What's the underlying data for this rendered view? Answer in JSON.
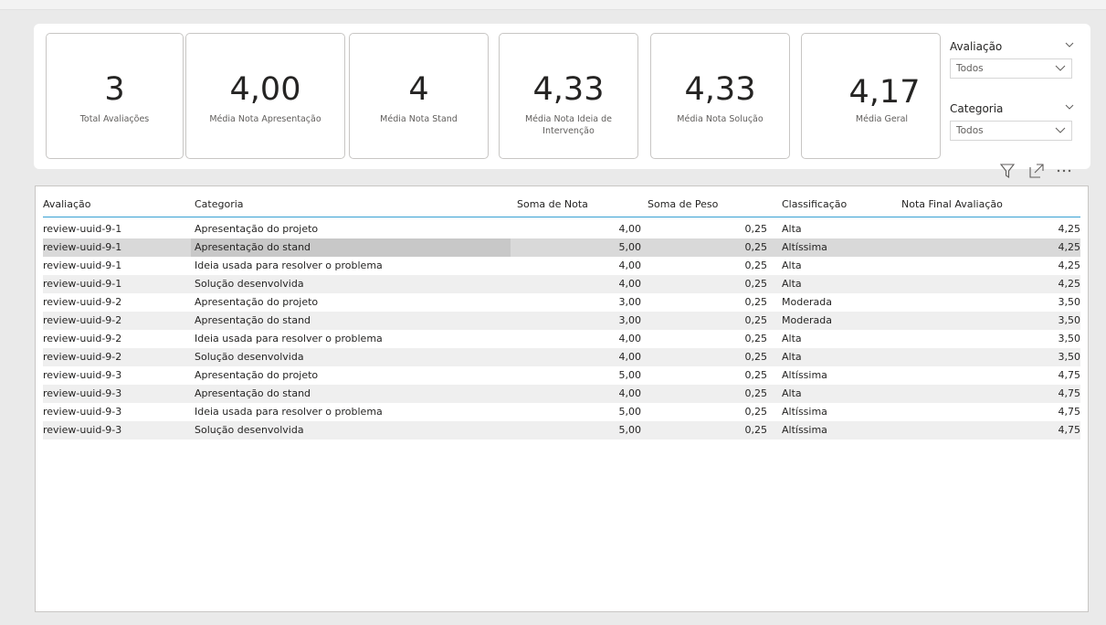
{
  "kpis": [
    {
      "value": "3",
      "label": "Total Avaliações"
    },
    {
      "value": "4,00",
      "label": "Média Nota Apresentação"
    },
    {
      "value": "4",
      "label": "Média Nota Stand"
    },
    {
      "value": "4,33",
      "label": "Média Nota Ideia de Intervenção"
    },
    {
      "value": "4,33",
      "label": "Média Nota Solução"
    },
    {
      "value": "4,17",
      "label": "Média Geral"
    }
  ],
  "slicers": [
    {
      "title": "Avaliação",
      "selected": "Todos"
    },
    {
      "title": "Categoria",
      "selected": "Todos"
    }
  ],
  "table": {
    "columns": [
      "Avaliação",
      "Categoria",
      "Soma de Nota",
      "Soma de Peso",
      "Classificação",
      "Nota Final Avaliação"
    ],
    "rows": [
      [
        "review-uuid-9-1",
        "Apresentação do projeto",
        "4,00",
        "0,25",
        "Alta",
        "4,25"
      ],
      [
        "review-uuid-9-1",
        "Apresentação do stand",
        "5,00",
        "0,25",
        "Altíssima",
        "4,25"
      ],
      [
        "review-uuid-9-1",
        "Ideia usada para resolver o problema",
        "4,00",
        "0,25",
        "Alta",
        "4,25"
      ],
      [
        "review-uuid-9-1",
        "Solução desenvolvida",
        "4,00",
        "0,25",
        "Alta",
        "4,25"
      ],
      [
        "review-uuid-9-2",
        "Apresentação do projeto",
        "3,00",
        "0,25",
        "Moderada",
        "3,50"
      ],
      [
        "review-uuid-9-2",
        "Apresentação do stand",
        "3,00",
        "0,25",
        "Moderada",
        "3,50"
      ],
      [
        "review-uuid-9-2",
        "Ideia usada para resolver o problema",
        "4,00",
        "0,25",
        "Alta",
        "3,50"
      ],
      [
        "review-uuid-9-2",
        "Solução desenvolvida",
        "4,00",
        "0,25",
        "Alta",
        "3,50"
      ],
      [
        "review-uuid-9-3",
        "Apresentação do projeto",
        "5,00",
        "0,25",
        "Altíssima",
        "4,75"
      ],
      [
        "review-uuid-9-3",
        "Apresentação do stand",
        "4,00",
        "0,25",
        "Alta",
        "4,75"
      ],
      [
        "review-uuid-9-3",
        "Ideia usada para resolver o problema",
        "5,00",
        "0,25",
        "Altíssima",
        "4,75"
      ],
      [
        "review-uuid-9-3",
        "Solução desenvolvida",
        "5,00",
        "0,25",
        "Altíssima",
        "4,75"
      ]
    ]
  },
  "icons": {
    "filter": "filter-icon",
    "focus": "focus-mode-icon",
    "more": "more-options-icon",
    "chevron": "chevron-down-icon"
  }
}
